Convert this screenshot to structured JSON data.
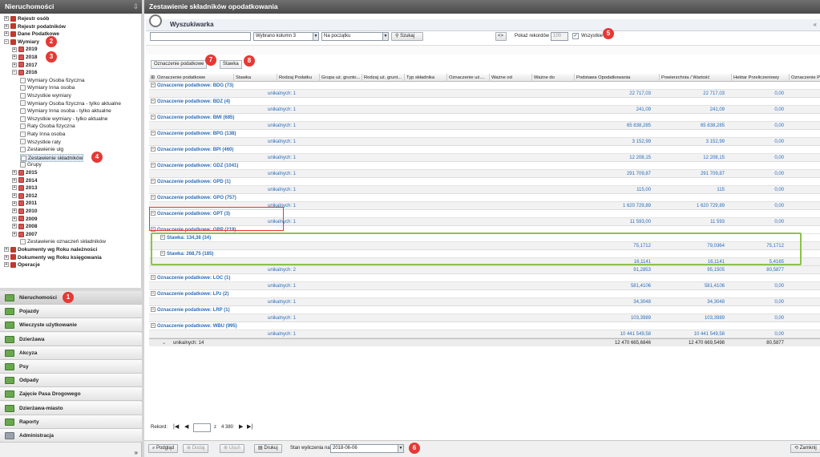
{
  "left_panel": {
    "title": "Nieruchomości",
    "tree": [
      {
        "label": "Rejestr osób",
        "bold": true,
        "indent": 0
      },
      {
        "label": "Rejestr podatników",
        "bold": true,
        "indent": 0
      },
      {
        "label": "Dane Podatkowe",
        "bold": true,
        "indent": 0
      },
      {
        "label": "Wymiary",
        "bold": true,
        "indent": 0,
        "badge": "2"
      },
      {
        "label": "2019",
        "bold": true,
        "indent": 1
      },
      {
        "label": "2018",
        "bold": true,
        "indent": 1,
        "badge": "3"
      },
      {
        "label": "2017",
        "bold": true,
        "indent": 1
      },
      {
        "label": "2016",
        "bold": true,
        "indent": 1
      },
      {
        "label": "Wymiary Osoba fizyczna",
        "indent": 2
      },
      {
        "label": "Wymiary Inna osoba",
        "indent": 2
      },
      {
        "label": "Wszystkie wymiary",
        "indent": 2
      },
      {
        "label": "Wymiary Osoba fizyczna - tylko aktualne",
        "indent": 2
      },
      {
        "label": "Wymiary Inna osoba - tylko aktualne",
        "indent": 2
      },
      {
        "label": "Wszystkie wymiary - tylko aktualne",
        "indent": 2
      },
      {
        "label": "Raty Osoba fizyczna",
        "indent": 2
      },
      {
        "label": "Raty Inna osoba",
        "indent": 2
      },
      {
        "label": "Wszystkie raty",
        "indent": 2
      },
      {
        "label": "Zestawienie ulg",
        "indent": 2
      },
      {
        "label": "Zestawienie składników",
        "indent": 2,
        "selected": true,
        "badge": "4"
      },
      {
        "label": "Grupy",
        "indent": 2
      },
      {
        "label": "2015",
        "bold": true,
        "indent": 1
      },
      {
        "label": "2014",
        "bold": true,
        "indent": 1
      },
      {
        "label": "2013",
        "bold": true,
        "indent": 1
      },
      {
        "label": "2012",
        "bold": true,
        "indent": 1
      },
      {
        "label": "2011",
        "bold": true,
        "indent": 1
      },
      {
        "label": "2010",
        "bold": true,
        "indent": 1
      },
      {
        "label": "2009",
        "bold": true,
        "indent": 1
      },
      {
        "label": "2008",
        "bold": true,
        "indent": 1
      },
      {
        "label": "2007",
        "bold": true,
        "indent": 1
      },
      {
        "label": "Zestawienie oznaczeń składników",
        "indent": 2
      },
      {
        "label": "Dokumenty wg Roku należności",
        "bold": true,
        "indent": 0
      },
      {
        "label": "Dokumenty wg Roku księgowania",
        "bold": true,
        "indent": 0
      },
      {
        "label": "Operacje",
        "bold": true,
        "indent": 0
      }
    ],
    "nav": [
      {
        "label": "Nieruchomości",
        "active": true,
        "badge": "1"
      },
      {
        "label": "Pojazdy"
      },
      {
        "label": "Wieczyste użytkowanie"
      },
      {
        "label": "Dzierżawa"
      },
      {
        "label": "Akcyza"
      },
      {
        "label": "Psy"
      },
      {
        "label": "Odpady"
      },
      {
        "label": "Zajęcie Pasa Drogowego"
      },
      {
        "label": "Dzierżawa-miasto"
      },
      {
        "label": "Raporty"
      },
      {
        "label": "Administracja"
      }
    ],
    "more": "»"
  },
  "main": {
    "title": "Zestawienie składników opodatkowania",
    "search": {
      "title": "Wyszukiwarka",
      "collapse": "«",
      "columns_value": "Wybrano kolumn 3",
      "position_value": "Na początku",
      "search_button": "Szukaj",
      "arrow_button": "<>",
      "records_label": "Pokaż rekordów",
      "records_value": "100",
      "all_label": "Wszystkie",
      "all_checked": "✓",
      "badge": "5"
    },
    "grouping": {
      "tab1": "Oznaczenie podatkowe",
      "tab1_badge": "7",
      "tab2": "Stawka",
      "tab2_badge": "8"
    },
    "columns": [
      "Oznaczenie podatkowe",
      "Stawka",
      "Rodzaj Podatku",
      "Grupa uż. grunto...",
      "Rodzaj uż. grunt...",
      "Typ składnika",
      "Oznaczenie uż....",
      "Ważne od",
      "Ważne do",
      "Podstawa Opodatkowania",
      "Powierzchnia / Wartość",
      "Hektar Przeliczeniowy",
      "Oznaczenie Prz..."
    ],
    "rows": [
      {
        "type": "group",
        "label": "Oznaczenie podatkowe:",
        "code": "BDG",
        "count": "(73)"
      },
      {
        "type": "sum",
        "uniq": "unikalnych: 1",
        "v1": "22 717,03",
        "v2": "22 717,03",
        "v3": "0,00"
      },
      {
        "type": "group",
        "label": "Oznaczenie podatkowe:",
        "code": "BDZ",
        "count": "(4)"
      },
      {
        "type": "sum",
        "uniq": "unikalnych: 1",
        "v1": "241,09",
        "v2": "241,09",
        "v3": "0,00"
      },
      {
        "type": "group",
        "label": "Oznaczenie podatkowe:",
        "code": "BMI",
        "count": "(685)"
      },
      {
        "type": "sum",
        "uniq": "unikalnych: 1",
        "v1": "65 838,285",
        "v2": "65 838,285",
        "v3": "0,00"
      },
      {
        "type": "group",
        "label": "Oznaczenie podatkowe:",
        "code": "BPG",
        "count": "(138)"
      },
      {
        "type": "sum",
        "uniq": "unikalnych: 1",
        "v1": "3 152,99",
        "v2": "3 152,99",
        "v3": "0,00"
      },
      {
        "type": "group",
        "label": "Oznaczenie podatkowe:",
        "code": "BPI",
        "count": "(460)"
      },
      {
        "type": "sum",
        "uniq": "unikalnych: 1",
        "v1": "12 208,15",
        "v2": "12 208,15",
        "v3": "0,00"
      },
      {
        "type": "group",
        "label": "Oznaczenie podatkowe:",
        "code": "GDZ",
        "count": "(1041)"
      },
      {
        "type": "sum",
        "uniq": "unikalnych: 1",
        "v1": "291 709,87",
        "v2": "291 709,87",
        "v3": "0,00"
      },
      {
        "type": "group",
        "label": "Oznaczenie podatkowe:",
        "code": "GPD",
        "count": "(1)"
      },
      {
        "type": "sum",
        "uniq": "unikalnych: 1",
        "v1": "115,00",
        "v2": "115",
        "v3": "0,00"
      },
      {
        "type": "group",
        "label": "Oznaczenie podatkowe:",
        "code": "GPO",
        "count": "(757)"
      },
      {
        "type": "sum",
        "uniq": "unikalnych: 1",
        "v1": "1 620 729,89",
        "v2": "1 620 729,89",
        "v3": "0,00"
      },
      {
        "type": "group",
        "label": "Oznaczenie podatkowe:",
        "code": "GPT",
        "count": "(3)"
      },
      {
        "type": "sum",
        "uniq": "unikalnych: 1",
        "v1": "11 593,00",
        "v2": "11 593",
        "v3": "0,00"
      },
      {
        "type": "group",
        "label": "Oznaczenie podatkowe:",
        "code": "GRP",
        "count": "(219)"
      },
      {
        "type": "sub",
        "label": "Stawka:",
        "code": "134,38",
        "count": "(34)"
      },
      {
        "type": "sum",
        "uniq": "",
        "v1": "75,1712",
        "v2": "79,0364",
        "v3": "75,1712"
      },
      {
        "type": "sub",
        "label": "Stawka:",
        "code": "268,75",
        "count": "(185)"
      },
      {
        "type": "sum",
        "uniq": "",
        "v1": "16,1141",
        "v2": "16,1141",
        "v3": "5,4165"
      },
      {
        "type": "sum",
        "uniq": "unikalnych: 2",
        "v1": "91,2853",
        "v2": "95,1505",
        "v3": "80,5877"
      },
      {
        "type": "group",
        "label": "Oznaczenie podatkowe:",
        "code": "LOC",
        "count": "(1)"
      },
      {
        "type": "sum",
        "uniq": "unikalnych: 1",
        "v1": "581,4106",
        "v2": "581,4106",
        "v3": "0,00"
      },
      {
        "type": "group",
        "label": "Oznaczenie podatkowe:",
        "code": "LPz",
        "count": "(2)"
      },
      {
        "type": "sum",
        "uniq": "unikalnych: 1",
        "v1": "34,3048",
        "v2": "34,3048",
        "v3": "0,00"
      },
      {
        "type": "group",
        "label": "Oznaczenie podatkowe:",
        "code": "LRP",
        "count": "(1)"
      },
      {
        "type": "sum",
        "uniq": "unikalnych: 1",
        "v1": "103,3989",
        "v2": "103,3989",
        "v3": "0,00"
      },
      {
        "type": "group",
        "label": "Oznaczenie podatkowe:",
        "code": "WBU",
        "count": "(995)"
      },
      {
        "type": "sum",
        "uniq": "unikalnych: 1",
        "v1": "10 441 549,58",
        "v2": "10 441 549,58",
        "v3": "0,00"
      }
    ],
    "footer": {
      "uniq": "unikalnych: 14",
      "v1": "12 470 665,6846",
      "v2": "12 470 669,5498",
      "v3": "80,5877"
    },
    "pager": {
      "label": "Rekord:",
      "value": "",
      "of": "z",
      "total": "4 380"
    },
    "bottom": {
      "preview": "Podgląd",
      "add": "Dodaj",
      "delete": "Usuń",
      "print": "Drukuj",
      "state_label": "Stan wyliczenia na",
      "state_value": "2018-06-06",
      "badge": "6",
      "close": "Zamknij"
    },
    "badges": {
      "b7": "7",
      "b8": "8"
    }
  }
}
